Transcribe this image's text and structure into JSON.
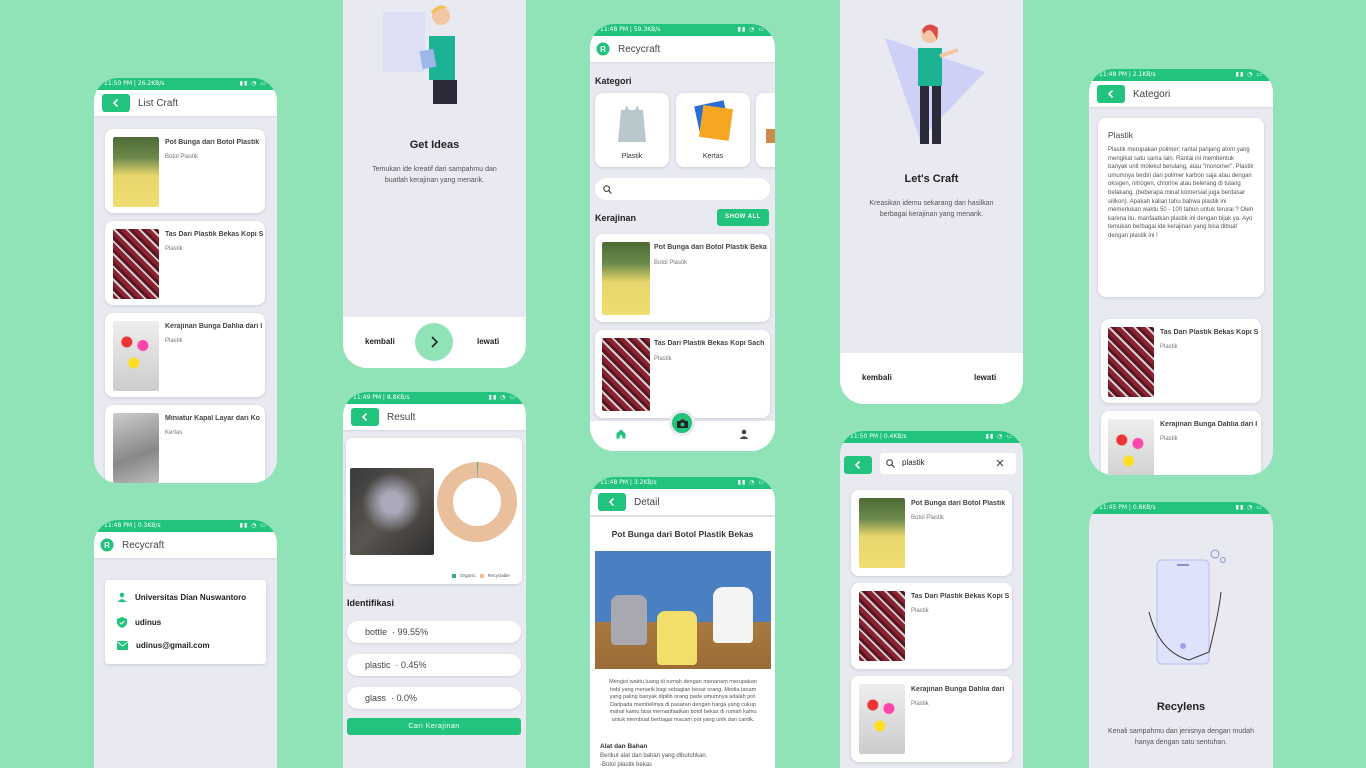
{
  "list_craft": {
    "status_time": "11:50 PM | 26.2KB/s",
    "title": "List Craft",
    "items": [
      {
        "title": "Pot Bunga dari Botol Plastik",
        "sub": "Botol Plastik"
      },
      {
        "title": "Tas Dari Plastik Bekas Kopi S",
        "sub": "Plastik"
      },
      {
        "title": "Kerajinan Bunga Dahlia dari I",
        "sub": "Plastik"
      },
      {
        "title": "Miniatur Kapal Layar dari Ko",
        "sub": "Kertas"
      }
    ]
  },
  "profile": {
    "status_time": "11:48 PM | 0.3KB/s",
    "app_name": "Recycraft",
    "university": "Universitas Dian Nuswantoro",
    "username": "udinus",
    "email": "udinus@gmail.com"
  },
  "onboard_ideas": {
    "title": "Get Ideas",
    "desc": "Temukan ide kreatif dari sampahmu dan buatlah kerajinan yang menarik.",
    "back": "kembali",
    "skip": "lewati"
  },
  "result": {
    "status_time": "11:49 PM | 8.8KB/s",
    "title": "Result",
    "legend_organic": "Organic",
    "legend_recyclable": "Recyclable",
    "section": "Identifikasi",
    "rows": [
      {
        "label": "bottle",
        "value": "· 99.55%"
      },
      {
        "label": "plastic",
        "value": "· 0.45%"
      },
      {
        "label": "glass",
        "value": "· 0.0%"
      }
    ],
    "button": "Cari Kerajinan",
    "chart_data": {
      "type": "pie",
      "categories": [
        "Organic",
        "Recyclable"
      ],
      "values": [
        0.45,
        99.55
      ],
      "colors": [
        "#3ea79a",
        "#e9bf9c"
      ]
    }
  },
  "home": {
    "status_time": "11:48 PM | 59.3KB/s",
    "app_name": "Recycraft",
    "kategori_label": "Kategori",
    "categories": [
      {
        "label": "Plastik"
      },
      {
        "label": "Kertas"
      }
    ],
    "kerajinan_label": "Kerajinan",
    "show_all": "SHOW ALL",
    "items": [
      {
        "title": "Pot Bunga dari Botol Plastik Beka",
        "sub": "Botol Plastik"
      },
      {
        "title": "Tas Dari Plastik Bekas Kopi Sach",
        "sub": "Plastik"
      }
    ]
  },
  "detail": {
    "status_time": "11:48 PM | 3.2KB/s",
    "title": "Detail",
    "heading": "Pot Bunga dari Botol Plastik Bekas",
    "body": "Mengisi waktu luang di rumah dengan menanam merupakan hobi yang menarik bagi sebagian besar orang. Media tanam yang paling banyak dipilih orang pada umumnya adalah pot. Daripada membelinya di pasaran dengan harga yang cukup mahal kamu bisa memanfaatkan botol bekas di rumah kamu untuk membuat berbagai macam pot yang unik dan cantik.",
    "tools_heading": "Alat dan Bahan",
    "tools_text": "Berikut alat dan bahan yang dibutuhkan.",
    "tools_item": "-Botol plastik bekas"
  },
  "onboard_craft": {
    "title": "Let's Craft",
    "desc": "Kreasikan idemu sekarang dan hasilkan berbagai kerajinan yang menarik.",
    "back": "kembali",
    "skip": "lewati"
  },
  "search": {
    "status_time": "11:50 PM | 0.4KB/s",
    "query": "plastik",
    "items": [
      {
        "title": "Pot Bunga dari Botol Plastik",
        "sub": "Botol Plastik"
      },
      {
        "title": "Tas Dari Plastik Bekas Kopi S",
        "sub": "Plastik"
      },
      {
        "title": "Kerajinan Bunga Dahlia dari",
        "sub": "Plastik"
      }
    ]
  },
  "kategori": {
    "status_time": "11:48 PM | 2.1KB/s",
    "title": "Kategori",
    "heading": "Plastik",
    "desc": "Plastik merupakan polimer; rantai panjang atom yang mengikat satu sama lain. Rantai ini membentuk banyak unit molekul berulang, atau \"monomer\". Plastik umumnya terdiri dari polimer karbon saja atau dengan oksigen, nitrogen, chlorine atau belerang di tulang belakang. (beberapa minat komersial juga berdasar silikon). Apakah kalian tahu bahwa plastik ini memerlukan waktu 50 - 100 tahun untuk terurai ? Oleh karena itu, manfaatkan plastik ini dengan bijak ya. Ayo temukan berbagai ide kerajinan yang bisa dibuat dengan plastik ini !",
    "items": [
      {
        "title": "Tas Dari Plastik Bekas Kopi S",
        "sub": "Plastik"
      },
      {
        "title": "Kerajinan Bunga Dahlia dari I",
        "sub": "Plastik"
      }
    ]
  },
  "recylens": {
    "status_time": "11:45 PM | 0.8KB/s",
    "title": "Recylens",
    "desc": "Kenali sampahmu dan jenisnya dengan mudah hanya dengan satu sentuhan."
  },
  "colors": {
    "accent": "#22c37c",
    "background": "#8fe3b7",
    "screen": "#e8e9f1"
  }
}
